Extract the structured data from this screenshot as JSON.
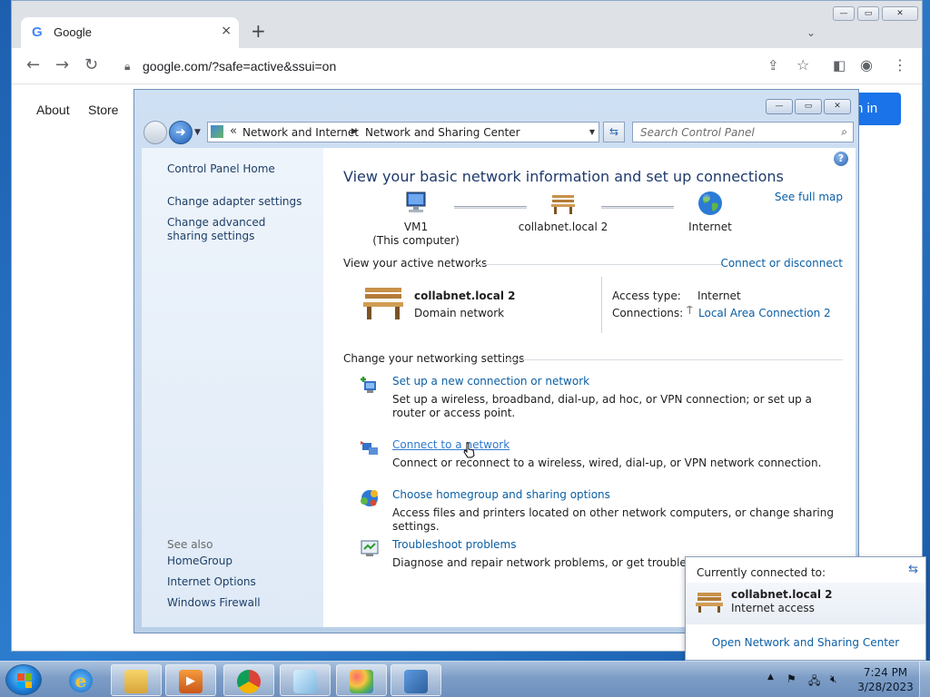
{
  "browser": {
    "tab_title": "Google",
    "tab_close": "×",
    "new_tab": "+",
    "tab_dropdown": "⌄",
    "url": "google.com/?safe=active&ssui=on",
    "page_links": {
      "about": "About",
      "store": "Store"
    },
    "signin_label": "n in"
  },
  "cp": {
    "breadcrumb": {
      "sep": "«",
      "level1": "Network and Internet",
      "level2": "Network and Sharing Center"
    },
    "search_placeholder": "Search Control Panel",
    "sidebar": {
      "home": "Control Panel Home",
      "adapter": "Change adapter settings",
      "advanced": "Change advanced sharing settings",
      "see_also": "See also",
      "see_also_items": [
        "HomeGroup",
        "Internet Options",
        "Windows Firewall"
      ]
    },
    "title": "View your basic network information and set up connections",
    "see_full_map": "See full map",
    "map": {
      "computer": "VM1",
      "computer_sub": "(This computer)",
      "network": "collabnet.local  2",
      "internet": "Internet"
    },
    "active_header": "View your active networks",
    "connect_disconnect": "Connect or disconnect",
    "active": {
      "name": "collabnet.local  2",
      "type": "Domain network",
      "access_label": "Access type:",
      "access_value": "Internet",
      "connections_label": "Connections:",
      "connections_value": "Local Area Connection 2"
    },
    "change_header": "Change your networking settings",
    "tasks": [
      {
        "link": "Set up a new connection or network",
        "desc": "Set up a wireless, broadband, dial-up, ad hoc, or VPN connection; or set up a router or access point."
      },
      {
        "link": "Connect to a network",
        "desc": "Connect or reconnect to a wireless, wired, dial-up, or VPN network connection."
      },
      {
        "link": "Choose homegroup and sharing options",
        "desc": "Access files and printers located on other network computers, or change sharing settings."
      },
      {
        "link": "Troubleshoot problems",
        "desc": "Diagnose and repair network problems, or get troubleshootin"
      }
    ]
  },
  "popup": {
    "header": "Currently connected to:",
    "network": "collabnet.local  2",
    "status": "Internet access",
    "link": "Open Network and Sharing Center"
  },
  "taskbar": {
    "time": "7:24 PM",
    "date": "3/28/2023"
  },
  "colors": {
    "link": "#0b5fa5",
    "title": "#1e3a6e",
    "chrome_accent": "#1a73e8"
  }
}
